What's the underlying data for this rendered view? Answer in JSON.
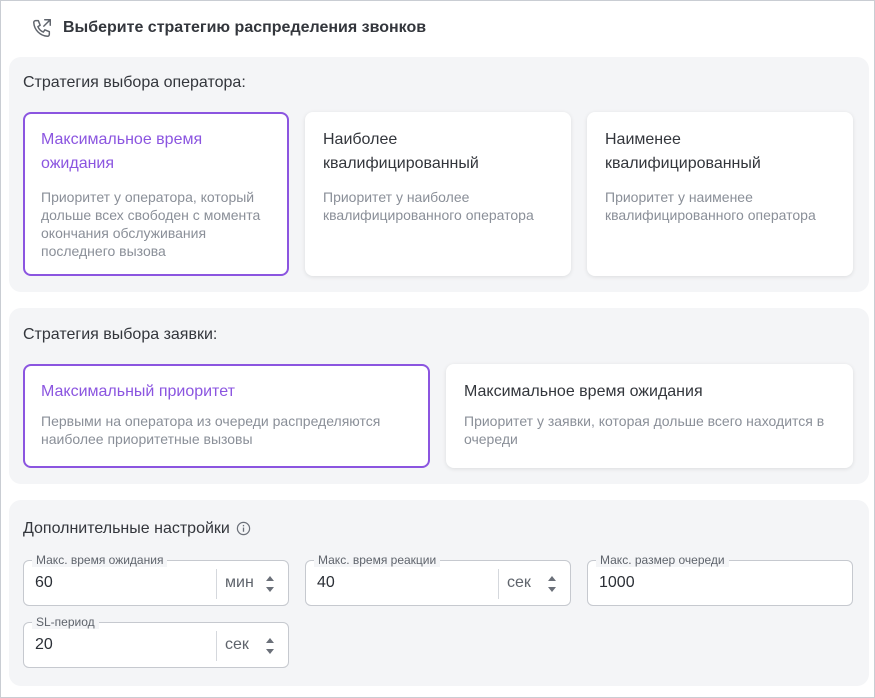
{
  "header": {
    "title": "Выберите стратегию распределения звонков",
    "icon": "phone-outgoing-icon"
  },
  "operator_strategy": {
    "title": "Стратегия выбора оператора:",
    "cards": [
      {
        "title": "Максимальное время ожидания",
        "desc": "Приоритет у оператора, который дольше всех свободен с момента окончания обслуживания последнего вызова",
        "selected": true
      },
      {
        "title": "Наиболее квалифицированный",
        "desc": "Приоритет у наиболее квалифицированного оператора",
        "selected": false
      },
      {
        "title": "Наименее квалифицированный",
        "desc": "Приоритет у наименее квалифицированного оператора",
        "selected": false
      }
    ]
  },
  "request_strategy": {
    "title": "Стратегия выбора заявки:",
    "cards": [
      {
        "title": "Максимальный приоритет",
        "desc": "Первыми на оператора из очереди распределяются наиболее приоритетные вызовы",
        "selected": true
      },
      {
        "title": "Максимальное время ожидания",
        "desc": "Приоритет у заявки, которая дольше всего находится в очереди",
        "selected": false
      }
    ]
  },
  "additional": {
    "title": "Дополнительные настройки",
    "fields": [
      {
        "label": "Макс. время ожидания",
        "value": "60",
        "unit": "мин"
      },
      {
        "label": "Макс. время реакции",
        "value": "40",
        "unit": "сек"
      },
      {
        "label": "Макс. размер очереди",
        "value": "1000",
        "unit": ""
      },
      {
        "label": "SL-период",
        "value": "20",
        "unit": "сек"
      }
    ]
  },
  "colors": {
    "accent": "#8b55e0",
    "section_bg": "#f4f5f7",
    "muted_text": "#8a8f98"
  }
}
